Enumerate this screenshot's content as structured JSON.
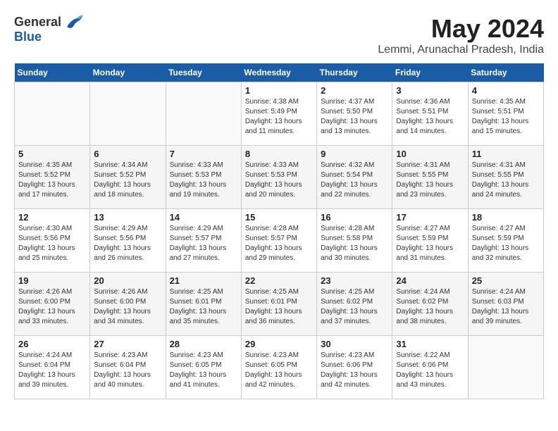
{
  "header": {
    "logo_general": "General",
    "logo_blue": "Blue",
    "month": "May 2024",
    "location": "Lemmi, Arunachal Pradesh, India"
  },
  "days_of_week": [
    "Sunday",
    "Monday",
    "Tuesday",
    "Wednesday",
    "Thursday",
    "Friday",
    "Saturday"
  ],
  "weeks": [
    [
      {
        "day": "",
        "info": ""
      },
      {
        "day": "",
        "info": ""
      },
      {
        "day": "",
        "info": ""
      },
      {
        "day": "1",
        "info": "Sunrise: 4:38 AM\nSunset: 5:49 PM\nDaylight: 13 hours\nand 11 minutes."
      },
      {
        "day": "2",
        "info": "Sunrise: 4:37 AM\nSunset: 5:50 PM\nDaylight: 13 hours\nand 13 minutes."
      },
      {
        "day": "3",
        "info": "Sunrise: 4:36 AM\nSunset: 5:51 PM\nDaylight: 13 hours\nand 14 minutes."
      },
      {
        "day": "4",
        "info": "Sunrise: 4:35 AM\nSunset: 5:51 PM\nDaylight: 13 hours\nand 15 minutes."
      }
    ],
    [
      {
        "day": "5",
        "info": "Sunrise: 4:35 AM\nSunset: 5:52 PM\nDaylight: 13 hours\nand 17 minutes."
      },
      {
        "day": "6",
        "info": "Sunrise: 4:34 AM\nSunset: 5:52 PM\nDaylight: 13 hours\nand 18 minutes."
      },
      {
        "day": "7",
        "info": "Sunrise: 4:33 AM\nSunset: 5:53 PM\nDaylight: 13 hours\nand 19 minutes."
      },
      {
        "day": "8",
        "info": "Sunrise: 4:33 AM\nSunset: 5:53 PM\nDaylight: 13 hours\nand 20 minutes."
      },
      {
        "day": "9",
        "info": "Sunrise: 4:32 AM\nSunset: 5:54 PM\nDaylight: 13 hours\nand 22 minutes."
      },
      {
        "day": "10",
        "info": "Sunrise: 4:31 AM\nSunset: 5:55 PM\nDaylight: 13 hours\nand 23 minutes."
      },
      {
        "day": "11",
        "info": "Sunrise: 4:31 AM\nSunset: 5:55 PM\nDaylight: 13 hours\nand 24 minutes."
      }
    ],
    [
      {
        "day": "12",
        "info": "Sunrise: 4:30 AM\nSunset: 5:56 PM\nDaylight: 13 hours\nand 25 minutes."
      },
      {
        "day": "13",
        "info": "Sunrise: 4:29 AM\nSunset: 5:56 PM\nDaylight: 13 hours\nand 26 minutes."
      },
      {
        "day": "14",
        "info": "Sunrise: 4:29 AM\nSunset: 5:57 PM\nDaylight: 13 hours\nand 27 minutes."
      },
      {
        "day": "15",
        "info": "Sunrise: 4:28 AM\nSunset: 5:57 PM\nDaylight: 13 hours\nand 29 minutes."
      },
      {
        "day": "16",
        "info": "Sunrise: 4:28 AM\nSunset: 5:58 PM\nDaylight: 13 hours\nand 30 minutes."
      },
      {
        "day": "17",
        "info": "Sunrise: 4:27 AM\nSunset: 5:59 PM\nDaylight: 13 hours\nand 31 minutes."
      },
      {
        "day": "18",
        "info": "Sunrise: 4:27 AM\nSunset: 5:59 PM\nDaylight: 13 hours\nand 32 minutes."
      }
    ],
    [
      {
        "day": "19",
        "info": "Sunrise: 4:26 AM\nSunset: 6:00 PM\nDaylight: 13 hours\nand 33 minutes."
      },
      {
        "day": "20",
        "info": "Sunrise: 4:26 AM\nSunset: 6:00 PM\nDaylight: 13 hours\nand 34 minutes."
      },
      {
        "day": "21",
        "info": "Sunrise: 4:25 AM\nSunset: 6:01 PM\nDaylight: 13 hours\nand 35 minutes."
      },
      {
        "day": "22",
        "info": "Sunrise: 4:25 AM\nSunset: 6:01 PM\nDaylight: 13 hours\nand 36 minutes."
      },
      {
        "day": "23",
        "info": "Sunrise: 4:25 AM\nSunset: 6:02 PM\nDaylight: 13 hours\nand 37 minutes."
      },
      {
        "day": "24",
        "info": "Sunrise: 4:24 AM\nSunset: 6:02 PM\nDaylight: 13 hours\nand 38 minutes."
      },
      {
        "day": "25",
        "info": "Sunrise: 4:24 AM\nSunset: 6:03 PM\nDaylight: 13 hours\nand 39 minutes."
      }
    ],
    [
      {
        "day": "26",
        "info": "Sunrise: 4:24 AM\nSunset: 6:04 PM\nDaylight: 13 hours\nand 39 minutes."
      },
      {
        "day": "27",
        "info": "Sunrise: 4:23 AM\nSunset: 6:04 PM\nDaylight: 13 hours\nand 40 minutes."
      },
      {
        "day": "28",
        "info": "Sunrise: 4:23 AM\nSunset: 6:05 PM\nDaylight: 13 hours\nand 41 minutes."
      },
      {
        "day": "29",
        "info": "Sunrise: 4:23 AM\nSunset: 6:05 PM\nDaylight: 13 hours\nand 42 minutes."
      },
      {
        "day": "30",
        "info": "Sunrise: 4:23 AM\nSunset: 6:06 PM\nDaylight: 13 hours\nand 42 minutes."
      },
      {
        "day": "31",
        "info": "Sunrise: 4:22 AM\nSunset: 6:06 PM\nDaylight: 13 hours\nand 43 minutes."
      },
      {
        "day": "",
        "info": ""
      }
    ]
  ]
}
